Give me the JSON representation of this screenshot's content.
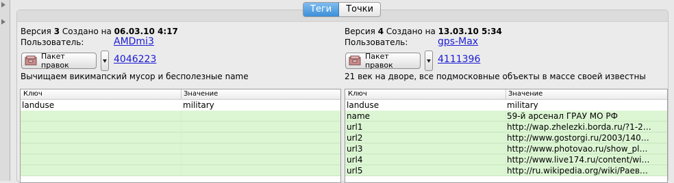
{
  "tabs": [
    {
      "label": "Теги",
      "active": true
    },
    {
      "label": "Точки",
      "active": false
    }
  ],
  "left": {
    "version_prefix": "Версия",
    "version_num": "3",
    "created_label": "Создано на",
    "created_at": "06.03.10 4:17",
    "user_label": "Пользователь:",
    "user": "AMDmi3",
    "changeset_button": "Пакет правок",
    "changeset_id": "4046223",
    "comment": "Вычищаем викимапский мусор и бесполезные name",
    "header_key": "Ключ",
    "header_value": "Значение",
    "rows": [
      {
        "key": "landuse",
        "value": "military"
      }
    ]
  },
  "right": {
    "version_prefix": "Версия",
    "version_num": "4",
    "created_label": "Создано на",
    "created_at": "13.03.10 5:34",
    "user_label": "Пользователь:",
    "user": "gps-Max",
    "changeset_button": "Пакет правок",
    "changeset_id": "4111396",
    "comment": "21 век на дворе, все подмосковные объекты в массе своей известны",
    "header_key": "Ключ",
    "header_value": "Значение",
    "rows": [
      {
        "key": "landuse",
        "value": "military"
      },
      {
        "key": "name",
        "value": "59-й арсенал ГРАУ МО РФ"
      },
      {
        "key": "url1",
        "value": "http://wap.zhelezki.borda.ru/?1-2…"
      },
      {
        "key": "url2",
        "value": "http://www.gostorgi.ru/2003/140…"
      },
      {
        "key": "url3",
        "value": "http://www.photovao.ru/show_pl…"
      },
      {
        "key": "url4",
        "value": "http://www.live174.ru/content/wi…"
      },
      {
        "key": "url5",
        "value": "http://ru.wikipedia.org/wiki/Раев…"
      }
    ]
  },
  "colors": {
    "tab_active": "#4a97dc",
    "added_row": "#dcf5d3",
    "link": "#1a1ad6"
  },
  "icons": [
    "changeset-icon",
    "dropdown-arrow-icon",
    "expand-arrow-icon"
  ]
}
